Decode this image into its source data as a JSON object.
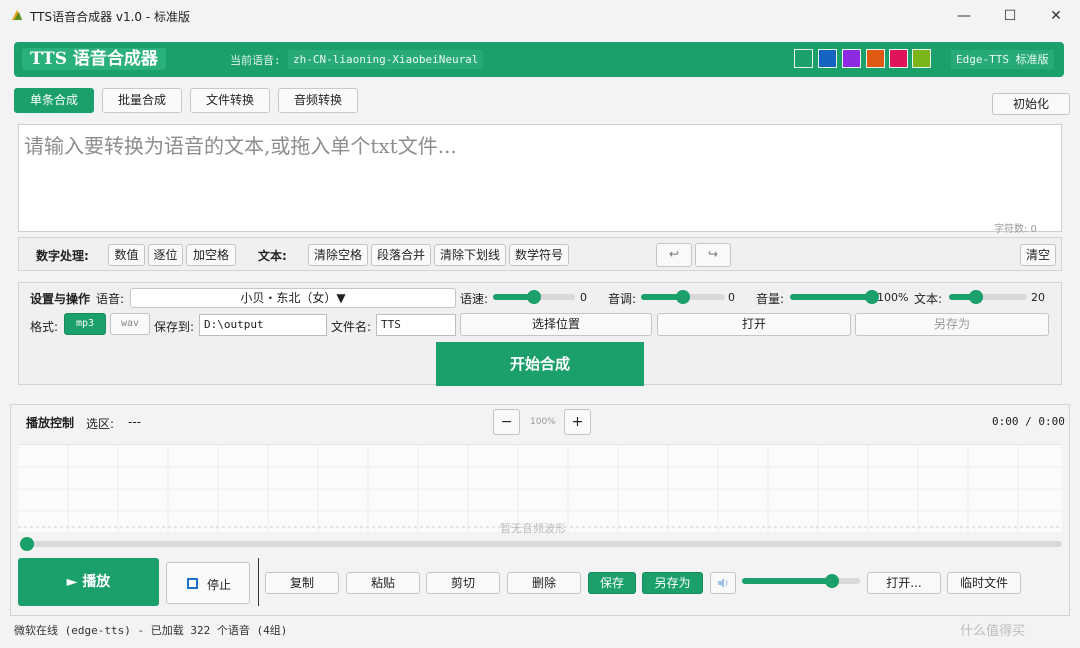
{
  "window": {
    "title": "TTS语音合成器 v1.0 - 标准版",
    "minimize_glyph": "—",
    "maximize_glyph": "☐",
    "close_glyph": "✕"
  },
  "header": {
    "brand": "TTS  语音合成器",
    "current_voice_label": "当前语音:",
    "current_voice_value": "zh-CN-liaoning-XiaobeiNeural",
    "theme_colors": [
      "#1b9f6b",
      "#1565c0",
      "#8e2be2",
      "#e05a14",
      "#e0145a",
      "#7cb518"
    ],
    "edition": "Edge-TTS  标准版"
  },
  "tabs": [
    {
      "label": "单条合成",
      "active": true
    },
    {
      "label": "批量合成",
      "active": false
    },
    {
      "label": "文件转换",
      "active": false
    },
    {
      "label": "音频转换",
      "active": false
    }
  ],
  "init_button": "初始化",
  "editor": {
    "placeholder": "请输入要转换为语音的文本,或拖入单个txt文件...",
    "char_count": "字符数: 0"
  },
  "toolbar": {
    "number_label": "数字处理:",
    "number_buttons": [
      "数值",
      "逐位",
      "加空格"
    ],
    "text_label": "文本:",
    "text_buttons": [
      "清除空格",
      "段落合并",
      "清除下划线",
      "数学符号"
    ],
    "undo_glyph": "↩",
    "redo_glyph": "↪",
    "clear": "清空"
  },
  "settings": {
    "section_label": "设置与操作",
    "voice_label": "语音:",
    "voice_value": "小贝・东北（女）▼",
    "rate_label": "语速:",
    "rate_value": "0",
    "rate_level": 0.5,
    "pitch_label": "音调:",
    "pitch_value": "0",
    "pitch_level": 0.5,
    "volume_label": "音量:",
    "volume_value": "100%",
    "volume_level": 1.0,
    "text_size_label": "文本:",
    "text_size_value": "20",
    "text_size_level": 0.35,
    "format_label": "格式:",
    "format_mp3": "mp3",
    "format_wav": "wav",
    "save_to_label": "保存到:",
    "save_to_value": "D:\\output",
    "filename_label": "文件名:",
    "filename_value": "TTS",
    "choose_location": "选择位置",
    "open": "打开",
    "save_as": "另存为",
    "start": "开始合成"
  },
  "playback": {
    "title": "播放控制",
    "selection_label": "选区:",
    "selection_value": "---",
    "zoom_out": "−",
    "zoom_value": "100%",
    "zoom_in": "+",
    "time": "0:00 / 0:00",
    "empty_wave": "暂无音频波形",
    "progress_level": 0.0,
    "play": "► 播放",
    "stop": "停止",
    "copy": "复制",
    "paste": "粘贴",
    "cut": "剪切",
    "delete": "删除",
    "save": "保存",
    "save_as": "另存为",
    "volume_level": 0.85,
    "open": "打开...",
    "temp_file": "临时文件"
  },
  "status": {
    "text": "微软在线 (edge-tts) - 已加载 322 个语音 (4组)"
  },
  "watermark": "什么值得买"
}
